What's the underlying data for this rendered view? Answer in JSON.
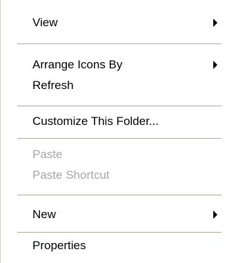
{
  "context_menu": {
    "items": [
      {
        "label": "View",
        "disabled": false,
        "submenu": true
      },
      {
        "label": "Arrange Icons By",
        "disabled": false,
        "submenu": true
      },
      {
        "label": "Refresh",
        "disabled": false,
        "submenu": false
      },
      {
        "label": "Customize This Folder...",
        "disabled": false,
        "submenu": false
      },
      {
        "label": "Paste",
        "disabled": true,
        "submenu": false
      },
      {
        "label": "Paste Shortcut",
        "disabled": true,
        "submenu": false
      },
      {
        "label": "New",
        "disabled": false,
        "submenu": true
      },
      {
        "label": "Properties",
        "disabled": false,
        "submenu": false
      }
    ],
    "colors": {
      "background": "#ffffff",
      "text": "#000000",
      "disabled_text": "#a7a6aa",
      "separator": "#aca899"
    }
  }
}
